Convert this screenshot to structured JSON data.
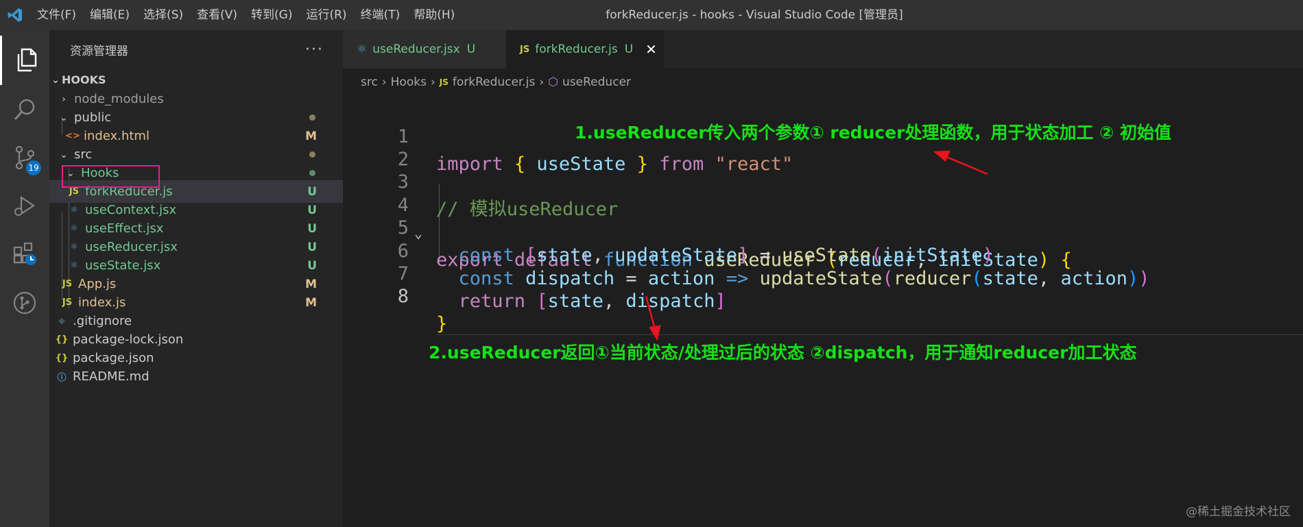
{
  "window": {
    "title": "forkReducer.js - hooks - Visual Studio Code [管理员]",
    "menu": [
      "文件(F)",
      "编辑(E)",
      "选择(S)",
      "查看(V)",
      "转到(G)",
      "运行(R)",
      "终端(T)",
      "帮助(H)"
    ]
  },
  "activity_bar": {
    "items": [
      "explorer-icon",
      "search-icon",
      "source-control-icon",
      "run-debug-icon",
      "extensions-icon",
      "git-graph-icon"
    ],
    "source_control_badge": "19"
  },
  "sidebar": {
    "title": "资源管理器",
    "more": "···",
    "project": "HOOKS",
    "items": [
      {
        "label": "node_modules",
        "type": "folder-closed",
        "status": ""
      },
      {
        "label": "public",
        "type": "folder-open",
        "status": "dot"
      },
      {
        "label": "index.html",
        "type": "html",
        "status": "M"
      },
      {
        "label": "src",
        "type": "folder-open",
        "status": "dot"
      },
      {
        "label": "Hooks",
        "type": "folder-open",
        "status": "dot-green"
      },
      {
        "label": "forkReducer.js",
        "type": "js",
        "status": "U"
      },
      {
        "label": "useContext.jsx",
        "type": "react",
        "status": "U"
      },
      {
        "label": "useEffect.jsx",
        "type": "react",
        "status": "U"
      },
      {
        "label": "useReducer.jsx",
        "type": "react",
        "status": "U"
      },
      {
        "label": "useState.jsx",
        "type": "react",
        "status": "U"
      },
      {
        "label": "App.js",
        "type": "js",
        "status": "M"
      },
      {
        "label": "index.js",
        "type": "js",
        "status": "M"
      },
      {
        "label": ".gitignore",
        "type": "git",
        "status": ""
      },
      {
        "label": "package-lock.json",
        "type": "json",
        "status": ""
      },
      {
        "label": "package.json",
        "type": "json",
        "status": ""
      },
      {
        "label": "README.md",
        "type": "info",
        "status": ""
      }
    ]
  },
  "tabs": [
    {
      "label": "useReducer.jsx",
      "status": "U",
      "icon": "react-icon"
    },
    {
      "label": "forkReducer.js",
      "status": "U",
      "icon": "js-icon",
      "close": "✕"
    }
  ],
  "breadcrumb": [
    "src",
    "Hooks",
    "forkReducer.js",
    "useReducer"
  ],
  "code": {
    "line_numbers": [
      "1",
      "2",
      "3",
      "4",
      "5",
      "6",
      "7",
      "8"
    ],
    "lines": [
      "import { useState } from \"react\"",
      "",
      "// 模拟useReducer",
      "export default function useReducer (reducer, initState) {",
      "  const [state, updateState] = useState(initState)",
      "  const dispatch = action => updateState(reducer(state, action))",
      "  return [state, dispatch]",
      "}"
    ]
  },
  "annotations": {
    "top": "1.useReducer传入两个参数① reducer处理函数，用于状态加工 ② 初始值",
    "bottom": "2.useReducer返回①当前状态/处理过后的状态 ②dispatch，用于通知reducer加工状态"
  },
  "watermark": "@稀土掘金技术社区",
  "colors": {
    "annotation": "#17e017",
    "highlight_box": "#e91e8c",
    "arrow": "#e8141e",
    "untracked": "#73c991",
    "modified": "#e2c08d"
  }
}
